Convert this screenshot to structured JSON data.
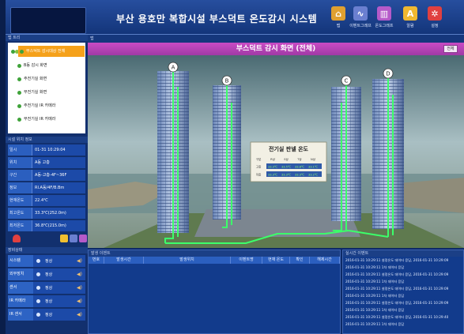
{
  "header": {
    "title": "부산 용호만 복합시설 부스덕트 온도감시 시스템",
    "tools": [
      {
        "label": "맵",
        "icon": "map-icon",
        "color": "#e0a030"
      },
      {
        "label": "이벤트그래프",
        "icon": "event-graph-icon",
        "color": "#6a7fd0"
      },
      {
        "label": "온도그래프",
        "icon": "temperature-graph-icon",
        "color": "#b55ac9"
      },
      {
        "label": "알람",
        "icon": "alarm-icon",
        "color": "#f0b830"
      },
      {
        "label": "설정",
        "icon": "settings-icon",
        "color": "#e04040"
      }
    ]
  },
  "left": {
    "tree_header": "맵 트리",
    "tree": [
      {
        "label": "부스덕트 감시대상 전체",
        "active": true
      },
      {
        "label": "B동 감시 화면",
        "active": false
      },
      {
        "label": "주전기실 화면",
        "active": false
      },
      {
        "label": "부전기실 화면",
        "active": false
      },
      {
        "label": "주전기실 IR 카메라",
        "active": false
      },
      {
        "label": "부전기실 IR 카메라",
        "active": false
      }
    ],
    "info_header": "시설 위치 정보",
    "info": [
      {
        "k": "일시",
        "v": "01-31 10:29:04"
      },
      {
        "k": "위치",
        "v": "A동 고층"
      },
      {
        "k": "구간",
        "v": "A동-고층-4F~36F"
      },
      {
        "k": "정보",
        "v": "RI.A동/4F/B.Bm"
      },
      {
        "k": "현재온도",
        "v": "22.4℃"
      },
      {
        "k": "최고온도",
        "v": "33.3℃(252.0m)"
      },
      {
        "k": "최저온도",
        "v": "36.8℃(215.0m)"
      }
    ],
    "equip_header": "장비상태",
    "equip": [
      {
        "k": "시스템",
        "st": "정상"
      },
      {
        "k": "외부장치",
        "st": "정상"
      },
      {
        "k": "센서",
        "st": "정상"
      },
      {
        "k": "IR 카메라",
        "st": "정상"
      },
      {
        "k": "IR 센서",
        "st": "정상"
      }
    ]
  },
  "main": {
    "sub_header": "맵",
    "title": "부스덕트 감시 화면 (전체)",
    "title_button": "전체",
    "building_labels": [
      "A",
      "B",
      "C",
      "D"
    ],
    "temp_panel": {
      "title": "전기실 판넬 온도",
      "headers": [
        "구분",
        "R상",
        "S상",
        "T상",
        "N상"
      ],
      "rows": [
        {
          "label": "고층",
          "values": [
            "33.3℃",
            "33.5℃",
            "33.8℃",
            "33.1℃"
          ]
        },
        {
          "label": "저층",
          "values": [
            "33.3℃",
            "33.3℃",
            "33.3℃",
            "33.2℃"
          ]
        }
      ]
    }
  },
  "event_table": {
    "header": "발생 이벤트",
    "columns": [
      "번호",
      "발생시간",
      "발생위치",
      "이벤트명",
      "현재 온도",
      "확인",
      "해제시간"
    ]
  },
  "log": {
    "header": "실시간 이벤트",
    "lines": [
      "2016-01-31 10:29:11 설정온도 데이터 응답, 2016-01-31 10:29:09",
      "2016-01-31 10:29:11 1차 데이터 응답",
      "2016-01-31 10:29:11 설정온도 데이터 응답, 2016-01-31 10:29:09",
      "2016-01-31 10:29:11 1차 데이터 응답",
      "2016-01-31 10:29:11 설정온도 데이터 응답, 2016-01-31 10:29:09",
      "2016-01-31 10:29:11 1차 데이터 응답",
      "2016-01-31 10:29:11 설정온도 데이터 응답, 2016-01-31 10:29:09",
      "2016-01-31 10:29:11 1차 데이터 응답",
      "2016-01-31 10:29:11 설정온도 데이터 응답, 2016-01-31 10:29:40",
      "2016-01-31 10:29:11 1차 데이터 응답"
    ]
  },
  "colors": {
    "accent_purple": "#b044b4",
    "active_orange": "#f5a11a",
    "busduct_green": "#3cff6a",
    "status_green": "#3fa33a"
  }
}
